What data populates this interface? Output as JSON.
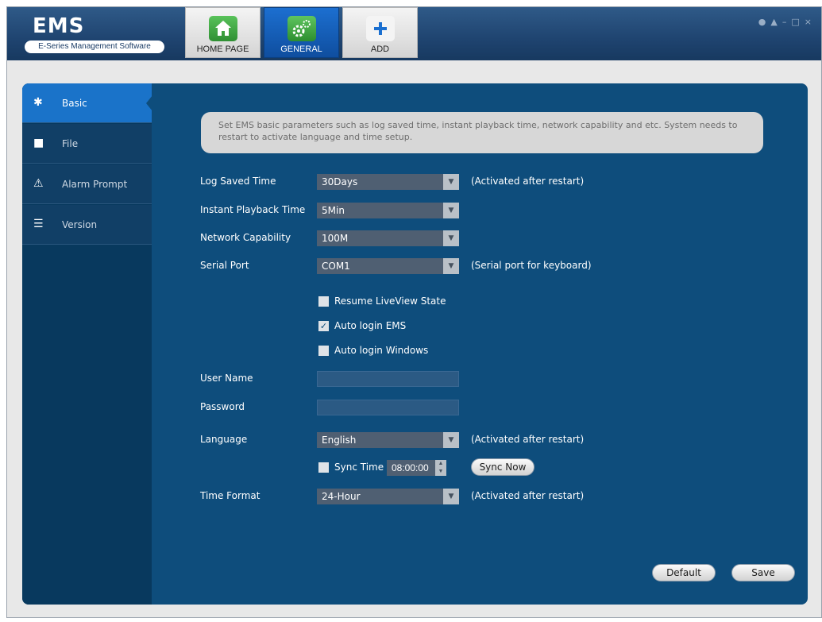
{
  "app": {
    "title": "EMS",
    "subtitle": "E-Series Management Software"
  },
  "nav": {
    "tabs": [
      {
        "label": "HOME PAGE",
        "icon": "home-icon"
      },
      {
        "label": "GENERAL",
        "icon": "gears-icon",
        "active": true
      },
      {
        "label": "ADD",
        "icon": "plus-icon"
      }
    ]
  },
  "window_controls": {
    "user": "user-icon",
    "lock": "lock-icon",
    "minimize": "minimize-icon",
    "maximize": "maximize-icon",
    "close": "close-icon"
  },
  "sidebar": {
    "items": [
      {
        "label": "Basic",
        "icon": "gear-icon",
        "active": true
      },
      {
        "label": "File",
        "icon": "save-icon"
      },
      {
        "label": "Alarm Prompt",
        "icon": "warning-icon"
      },
      {
        "label": "Version",
        "icon": "document-icon"
      }
    ]
  },
  "basic": {
    "info": "Set EMS basic parameters such as log saved time, instant playback time, network capability and etc. System needs to restart to activate language and time setup.",
    "log_saved_time": {
      "label": "Log Saved Time",
      "value": "30Days",
      "note": "(Activated after restart)"
    },
    "instant_playback_time": {
      "label": "Instant Playback Time",
      "value": "5Min"
    },
    "network_capability": {
      "label": "Network Capability",
      "value": "100M"
    },
    "serial_port": {
      "label": "Serial Port",
      "value": "COM1",
      "note": "(Serial port for keyboard)"
    },
    "resume_liveview": {
      "label": "Resume LiveView State",
      "checked": false
    },
    "auto_login_ems": {
      "label": "Auto login EMS",
      "checked": true
    },
    "auto_login_windows": {
      "label": "Auto login Windows",
      "checked": false
    },
    "user_name": {
      "label": "User Name",
      "value": ""
    },
    "password": {
      "label": "Password",
      "value": ""
    },
    "language": {
      "label": "Language",
      "value": "English",
      "note": "(Activated after restart)"
    },
    "sync_time": {
      "label": "Sync Time",
      "value": "08:00:00",
      "checked": false,
      "button": "Sync Now"
    },
    "time_format": {
      "label": "Time Format",
      "value": "24-Hour",
      "note": "(Activated after restart)"
    },
    "default_button": "Default",
    "save_button": "Save"
  },
  "colors": {
    "panel": "#0e4d7c",
    "sidebar_active": "#1a73c9",
    "nav_active": "#1565c0"
  }
}
